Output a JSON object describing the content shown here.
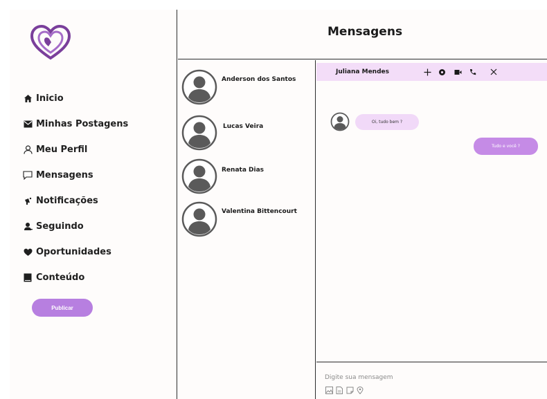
{
  "sidebar": {
    "items": [
      {
        "label": "Inicio",
        "icon": "home-icon"
      },
      {
        "label": "Minhas Postagens",
        "icon": "mail-icon"
      },
      {
        "label": "Meu Perfil",
        "icon": "user-icon"
      },
      {
        "label": "Mensagens",
        "icon": "chat-icon"
      },
      {
        "label": "Notificações",
        "icon": "megaphone-icon"
      },
      {
        "label": "Seguindo",
        "icon": "people-icon"
      },
      {
        "label": "Oportunidades",
        "icon": "heart-icon"
      },
      {
        "label": "Conteúdo",
        "icon": "book-icon"
      }
    ],
    "publish_label": "Publicar"
  },
  "header": {
    "title": "Mensagens"
  },
  "contacts": [
    {
      "name": "Anderson dos Santos"
    },
    {
      "name": "Lucas Veira"
    },
    {
      "name": "Renata Dias"
    },
    {
      "name": "Valentina Bittencourt"
    }
  ],
  "chat": {
    "contact_name": "Juliana Mendes",
    "actions": [
      "add-icon",
      "settings-icon",
      "video-icon",
      "phone-icon",
      "close-icon"
    ],
    "messages": [
      {
        "direction": "incoming",
        "text": "Oi, tudo bem ?"
      },
      {
        "direction": "outgoing",
        "text": "Tudo e você ?"
      }
    ],
    "input_placeholder": "Digite sua mensagem",
    "tools": [
      "image-icon",
      "file-icon",
      "sticker-icon",
      "location-icon"
    ]
  },
  "colors": {
    "accent": "#b77fe0",
    "chat_header_bg": "#f3ddf8",
    "incoming_bubble": "#f1d9f8",
    "outgoing_bubble": "#c58be6",
    "logo": "#7a3f9b"
  }
}
